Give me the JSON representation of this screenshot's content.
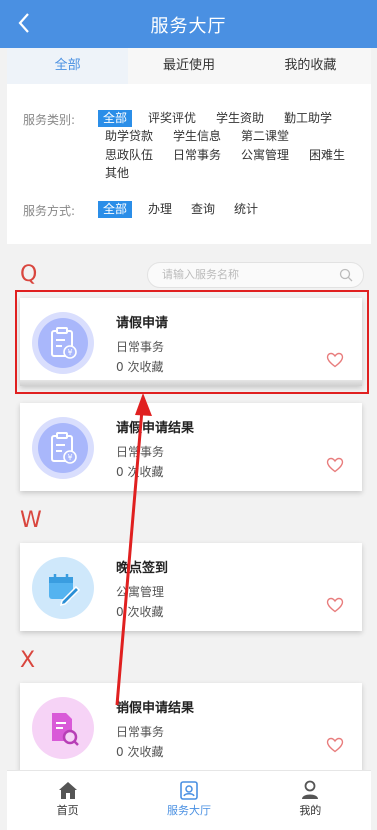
{
  "header": {
    "title": "服务大厅",
    "back_icon": "chevron-left-icon"
  },
  "tabs": [
    {
      "label": "全部",
      "active": true
    },
    {
      "label": "最近使用",
      "active": false
    },
    {
      "label": "我的收藏",
      "active": false
    }
  ],
  "filter": {
    "category_label": "服务类别:",
    "categories": [
      "全部",
      "评奖评优",
      "学生资助",
      "勤工助学",
      "助学贷款",
      "学生信息",
      "第二课堂",
      "思政队伍",
      "日常事务",
      "公寓管理",
      "困难生",
      "其他"
    ],
    "selected_category": "全部",
    "method_label": "服务方式:",
    "methods": [
      "全部",
      "办理",
      "查询",
      "统计"
    ],
    "selected_method": "全部"
  },
  "search": {
    "placeholder": "请输入服务名称",
    "icon": "search-icon"
  },
  "groups": [
    {
      "letter": "Q"
    },
    {
      "letter": "W"
    },
    {
      "letter": "X"
    }
  ],
  "cards": [
    {
      "name": "请假申请",
      "type": "日常事务",
      "count": "0 次收藏",
      "icon": "clipboard-yen-icon",
      "color": "#a9b7fb",
      "highlighted": true
    },
    {
      "name": "请假申请结果",
      "type": "日常事务",
      "count": "0 次收藏",
      "icon": "clipboard-yen-icon",
      "color": "#a9b7fb"
    },
    {
      "name": "晚点签到",
      "type": "公寓管理",
      "count": "0 次收藏",
      "icon": "calendar-edit-icon",
      "color": "#54b3f0"
    },
    {
      "name": "销假申请结果",
      "type": "日常事务",
      "count": "0 次收藏",
      "icon": "document-search-icon",
      "color": "#d95ad8"
    }
  ],
  "bottom_nav": [
    {
      "label": "首页",
      "icon": "home-icon",
      "active": false
    },
    {
      "label": "服务大厅",
      "icon": "service-hall-icon",
      "active": true
    },
    {
      "label": "我的",
      "icon": "user-icon",
      "active": false
    }
  ],
  "colors": {
    "primary": "#4a90e2",
    "chip_active": "#2b8ee8",
    "letter": "#d9463e",
    "highlight_box": "#e02020",
    "arrow": "#e02020"
  }
}
